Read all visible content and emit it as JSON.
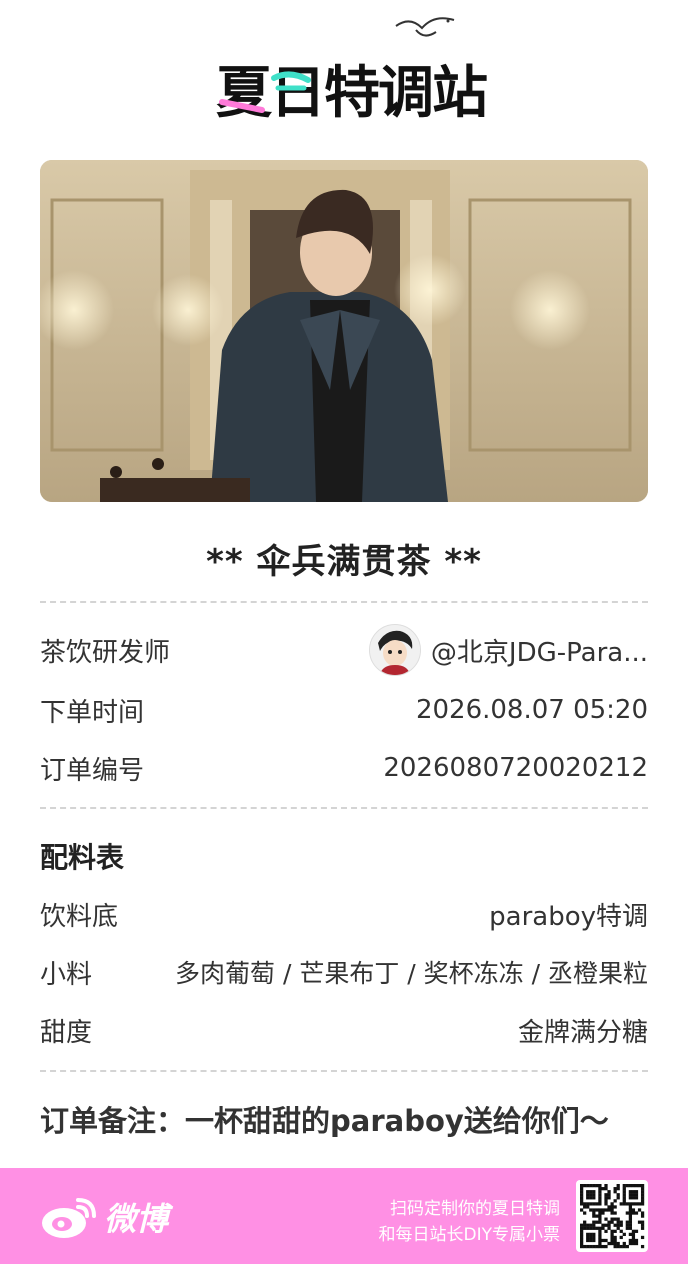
{
  "brand": {
    "logo_text": "夏日特调站"
  },
  "photo": {
    "icon": "portrait-photo"
  },
  "order": {
    "title": "** 伞兵满贯茶 **",
    "designer_label": "茶饮研发师",
    "designer_name": "@北京JDG-Para...",
    "time_label": "下单时间",
    "time_value": "2026.08.07  05:20",
    "number_label": "订单编号",
    "number_value": "2026080720020212"
  },
  "ingredients": {
    "title": "配料表",
    "base_label": "饮料底",
    "base_value": "paraboy特调",
    "toppings_label": "小料",
    "toppings_value": "多肉葡萄 / 芒果布丁 / 奖杯冻冻 / 丞橙果粒",
    "sweetness_label": "甜度",
    "sweetness_value": "金牌满分糖"
  },
  "note": {
    "text": "订单备注：一杯甜甜的paraboy送给你们～"
  },
  "footer": {
    "platform": "微博",
    "promo_line1": "扫码定制你的夏日特调",
    "promo_line2": "和每日站长DIY专属小票",
    "background_color": "#ff90e4"
  }
}
